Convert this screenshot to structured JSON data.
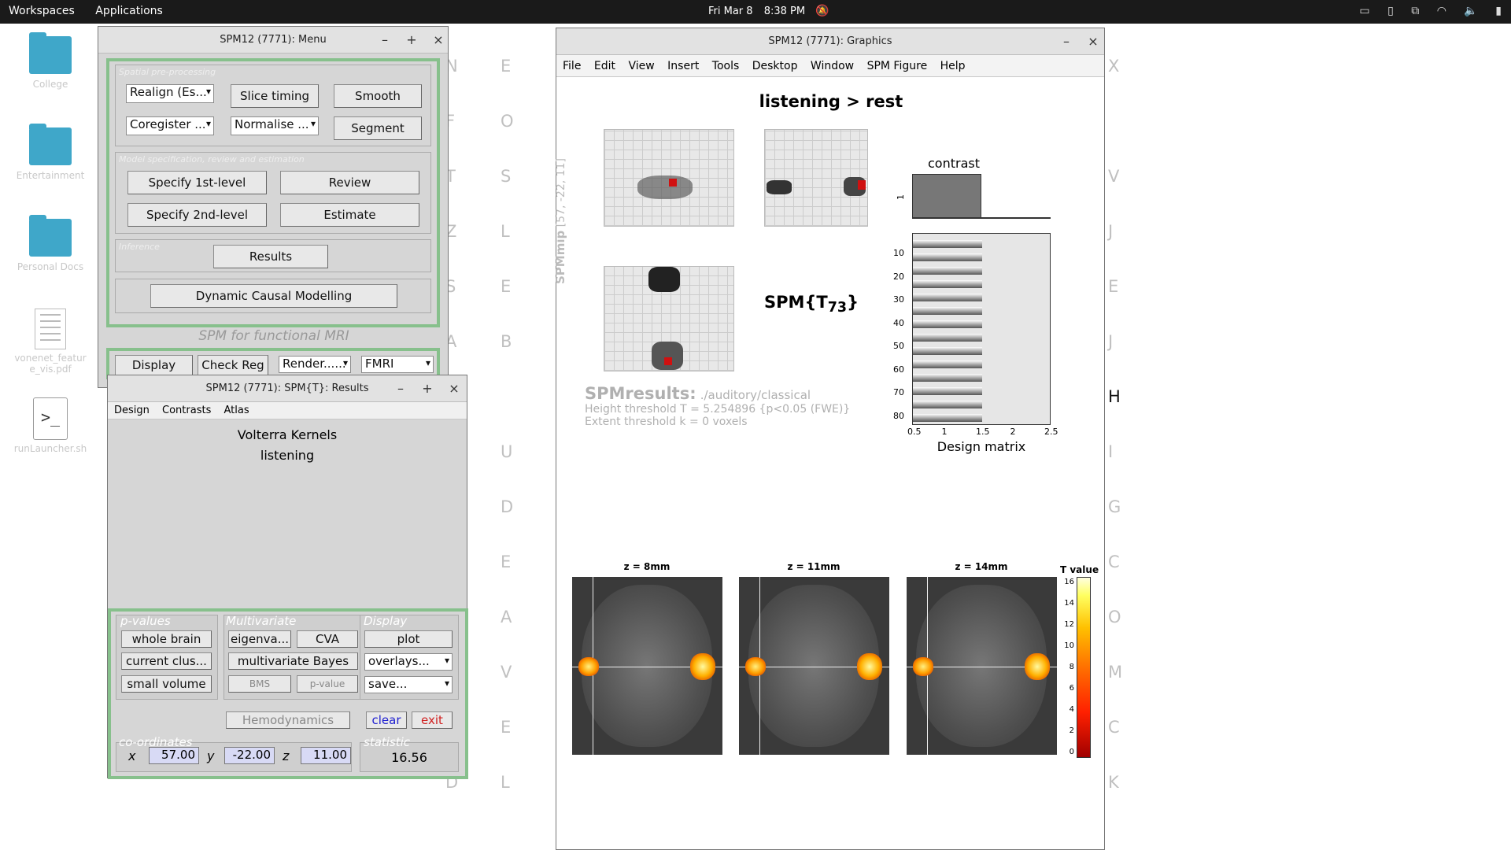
{
  "topbar": {
    "workspaces": "Workspaces",
    "applications": "Applications",
    "date": "Fri Mar 8",
    "time": "8:38 PM"
  },
  "wallpaper_letters": [
    "N",
    "E",
    "F",
    "O",
    "T",
    "S",
    "Z",
    "L",
    "S",
    "E",
    "A",
    "B",
    "A",
    "U",
    "D",
    "E",
    "A",
    "V",
    "E",
    "D",
    "L",
    "X",
    "V",
    "J",
    "E",
    "J",
    "H",
    "I",
    "G",
    "C",
    "O",
    "M",
    "C",
    "K"
  ],
  "desktop": {
    "icons": [
      {
        "label": "College",
        "kind": "folder"
      },
      {
        "label": "Entertainment",
        "kind": "folder"
      },
      {
        "label": "Personal Docs",
        "kind": "folder"
      },
      {
        "label": "vonenet_feature_vis.pdf",
        "kind": "file"
      },
      {
        "label": "runLauncher.sh",
        "kind": "script"
      }
    ]
  },
  "menu_window": {
    "title": "SPM12 (7771): Menu",
    "spatial_label": "Spatial pre-processing",
    "realign": "Realign (Es...",
    "slice_timing": "Slice timing",
    "smooth": "Smooth",
    "coregister": "Coregister ...",
    "normalise": "Normalise ...",
    "segment": "Segment",
    "model_label": "Model specification, review and estimation",
    "specify1": "Specify 1st-level",
    "review": "Review",
    "specify2": "Specify 2nd-level",
    "estimate": "Estimate",
    "inference_label": "Inference",
    "results": "Results",
    "dcm": "Dynamic Causal Modelling",
    "subtitle": "SPM for functional MRI",
    "display": "Display",
    "check_reg": "Check Reg",
    "render": "Render......",
    "modality": "FMRI"
  },
  "results_window": {
    "title": "SPM12 (7771): SPM{T}: Results",
    "menus": [
      "Design",
      "Contrasts",
      "Atlas"
    ],
    "line1": "Volterra Kernels",
    "line2": "listening",
    "pvalues_label": "p-values",
    "whole_brain": "whole brain",
    "current_cluster": "current clus...",
    "small_volume": "small volume",
    "multivariate_label": "Multivariate",
    "eigenvariate": "eigenva...",
    "cva": "CVA",
    "multivariate_bayes": "multivariate Bayes",
    "bms": "BMS",
    "pvalue": "p-value",
    "display_label": "Display",
    "plot": "plot",
    "overlays": "overlays...",
    "save": "save...",
    "hemodynamics": "Hemodynamics",
    "clear": "clear",
    "exit": "exit",
    "coords_label": "co-ordinates",
    "x_label": "x",
    "x_val": "57.00",
    "y_label": "y",
    "y_val": "-22.00",
    "z_label": "z",
    "z_val": "11.00",
    "statistic_label": "statistic",
    "statistic_val": "16.56"
  },
  "graphics_window": {
    "title": "SPM12 (7771): Graphics",
    "menus": [
      "File",
      "Edit",
      "View",
      "Insert",
      "Tools",
      "Desktop",
      "Window",
      "SPM Figure",
      "Help"
    ],
    "heading": "listening > rest",
    "spm_mip_label": "SPMmip",
    "mip_coords": "[57, -22, 11]",
    "spm_stat": "SPM{T",
    "spm_stat_sub": "73",
    "spm_stat_end": "}",
    "contrast_label": "contrast",
    "contrast_tick": "1",
    "design_label": "Design matrix",
    "design_yticks": [
      "10",
      "20",
      "30",
      "40",
      "50",
      "60",
      "70",
      "80"
    ],
    "design_xticks": [
      "0.5",
      "1",
      "1.5",
      "2",
      "2.5"
    ],
    "results_title": "SPMresults:",
    "results_path": "./auditory/classical",
    "height_threshold": "Height threshold T = 5.254896  {p<0.05 (FWE)}",
    "extent_threshold": "Extent threshold k = 0 voxels",
    "slices": [
      "z = 8mm",
      "z = 11mm",
      "z = 14mm"
    ],
    "colorbar_title": "T value",
    "colorbar_ticks": [
      "16",
      "14",
      "12",
      "10",
      "8",
      "6",
      "4",
      "2",
      "0"
    ]
  },
  "colors": {
    "green_frame": "#87c08c",
    "clear_blue": "#2020d0",
    "exit_red": "#d02020",
    "input_bg": "#d8daf5"
  }
}
